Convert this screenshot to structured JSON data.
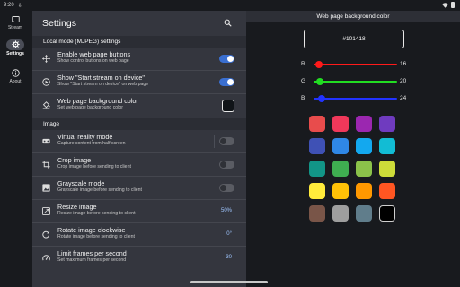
{
  "status": {
    "time": "9:20"
  },
  "rail": {
    "items": [
      {
        "label": "Stream",
        "icon": "cast-icon",
        "active": false
      },
      {
        "label": "Settings",
        "icon": "gear-icon",
        "active": true
      },
      {
        "label": "About",
        "icon": "info-icon",
        "active": false
      }
    ]
  },
  "settings": {
    "title": "Settings",
    "section_local": "Local mode (MJPEG) settings",
    "section_image": "Image",
    "rows": [
      {
        "title": "Enable web page buttons",
        "subtitle": "Show control buttons on web page",
        "icon": "move-icon",
        "control": "toggle",
        "on": true
      },
      {
        "title": "Show \"Start stream on device\"",
        "subtitle": "Show \"Start stream on device\" on web page",
        "icon": "play-circle-icon",
        "control": "toggle",
        "on": true
      },
      {
        "title": "Web page background color",
        "subtitle": "Set web page background color",
        "icon": "paint-bucket-icon",
        "control": "color",
        "color": "#101418"
      },
      {
        "title": "Virtual reality mode",
        "subtitle": "Capture content from half screen",
        "icon": "vr-icon",
        "control": "toggle",
        "on": false
      },
      {
        "title": "Crop image",
        "subtitle": "Crop image before sending to client",
        "icon": "crop-icon",
        "control": "toggle",
        "on": false
      },
      {
        "title": "Grayscale mode",
        "subtitle": "Grayscale image before sending to client",
        "icon": "image-icon",
        "control": "toggle",
        "on": false
      },
      {
        "title": "Resize image",
        "subtitle": "Resize image before sending to client",
        "icon": "resize-icon",
        "control": "value",
        "value": "50%"
      },
      {
        "title": "Rotate image clockwise",
        "subtitle": "Rotate image before sending to client",
        "icon": "rotate-icon",
        "control": "value",
        "value": "0°"
      },
      {
        "title": "Limit frames per second",
        "subtitle": "Set maximum frames per second",
        "icon": "speed-icon",
        "control": "value",
        "value": "30"
      }
    ]
  },
  "color_dialog": {
    "title": "Web page background color",
    "hex_value": "#101418",
    "sliders": [
      {
        "label": "R",
        "value": "16",
        "fraction": 0.063,
        "color": "#ff1a1a"
      },
      {
        "label": "G",
        "value": "20",
        "fraction": 0.078,
        "color": "#22dd22"
      },
      {
        "label": "B",
        "value": "24",
        "fraction": 0.094,
        "color": "#2233ff"
      }
    ],
    "palette": [
      "#e84c4c",
      "#f0385a",
      "#9b27b0",
      "#6f3bbf",
      "#3f51b5",
      "#2f87e6",
      "#13a8ef",
      "#12bcd4",
      "#129587",
      "#3fae51",
      "#8bc24a",
      "#cddc39",
      "#ffeb3b",
      "#ffc107",
      "#ff9800",
      "#ff5622",
      "#795548",
      "#9e9e9e",
      "#607d8b",
      "#000000"
    ]
  }
}
